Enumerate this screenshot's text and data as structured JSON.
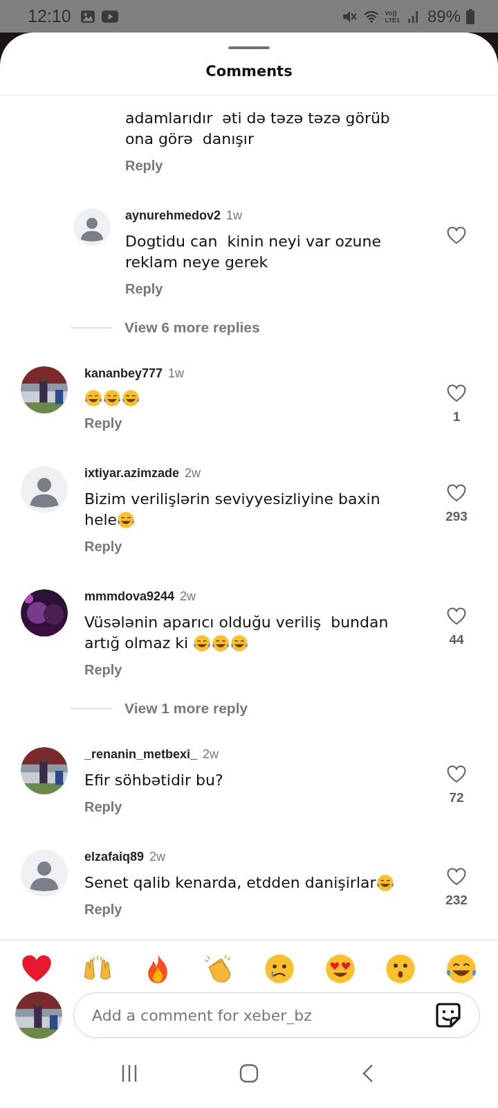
{
  "status_bar": {
    "time": "12:10",
    "network_top": "Vo))",
    "network_bottom": "LTE1",
    "battery": "89%"
  },
  "sheet": {
    "title": "Comments"
  },
  "comments": [
    {
      "kind": "comment",
      "reply": true,
      "text": "adamlarıdır  əti də təzə təzə görüb\nona görə  danışır",
      "reply_label": "Reply"
    },
    {
      "kind": "comment",
      "reply": true,
      "avatar": {
        "kind": "default"
      },
      "username": "aynurehmedov2",
      "time": "1w",
      "text": "Dogtidu can  kinin neyi var ozune\nreklam neye gerek",
      "reply_label": "Reply"
    },
    {
      "kind": "view-more",
      "label": "View 6 more replies"
    },
    {
      "kind": "comment",
      "reply": false,
      "username": "kananbey777",
      "time": "1w",
      "emoji": [
        {
          "kind": "tears-of-joy"
        },
        {
          "kind": "tears-of-joy"
        },
        {
          "kind": "tears-of-joy"
        }
      ],
      "reply_label": "Reply",
      "likes": "1"
    },
    {
      "kind": "comment",
      "reply": false,
      "avatar": {
        "kind": "default"
      },
      "username": "ixtiyar.azimzade",
      "time": "2w",
      "text": "Bizim verilişlərin seviyyesizliyine baxin\nhele",
      "emoji": [
        {
          "kind": "tears-of-joy"
        }
      ],
      "reply_label": "Reply",
      "likes": "293"
    },
    {
      "kind": "comment",
      "reply": false,
      "username": "mmmdova9244",
      "time": "2w",
      "text": "Vüsələnin aparıcı olduğu veriliş  bundan\nartığ olmaz ki ",
      "emoji": [
        {
          "kind": "tears-of-joy"
        },
        {
          "kind": "tears-of-joy"
        },
        {
          "kind": "tears-of-joy"
        }
      ],
      "reply_label": "Reply",
      "likes": "44"
    },
    {
      "kind": "view-more",
      "label": "View 1 more reply"
    },
    {
      "kind": "comment",
      "reply": false,
      "username": "_renanin_metbexi_",
      "time": "2w",
      "text": "Efir söhbətidir bu?",
      "reply_label": "Reply",
      "likes": "72"
    },
    {
      "kind": "comment",
      "reply": false,
      "avatar": {
        "kind": "default"
      },
      "username": "elzafaiq89",
      "time": "2w",
      "text": "Senet qalib kenarda, etdden danişirlar",
      "emoji": [
        {
          "kind": "tears-of-joy"
        }
      ],
      "reply_label": "Reply",
      "likes": "232"
    }
  ],
  "reactions": [
    {
      "kind": "heart"
    },
    {
      "kind": "raised-hands"
    },
    {
      "kind": "fire"
    },
    {
      "kind": "clap"
    },
    {
      "kind": "crying"
    },
    {
      "kind": "heart-eyes"
    },
    {
      "kind": "surprised"
    },
    {
      "kind": "tears-of-joy"
    }
  ],
  "composer": {
    "placeholder": "Add a comment for xeber_bz"
  }
}
